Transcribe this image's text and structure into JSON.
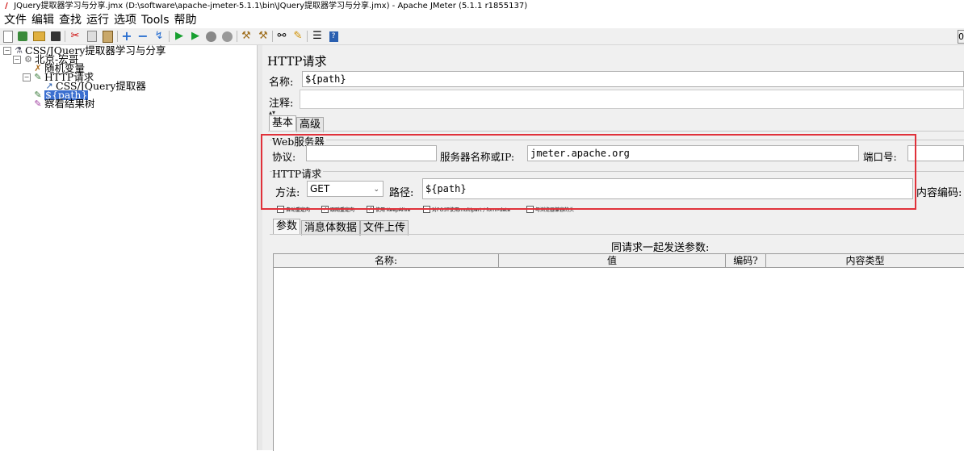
{
  "window": {
    "title": "JQuery提取器学习与分享.jmx (D:\\software\\apache-jmeter-5.1.1\\bin\\JQuery提取器学习与分享.jmx) - Apache JMeter (5.1.1 r1855137)"
  },
  "menu": [
    "文件",
    "编辑",
    "查找",
    "运行",
    "选项",
    "Tools",
    "帮助"
  ],
  "toolbar": {
    "icons": [
      "new-icon",
      "templates-icon",
      "open-icon",
      "save-icon",
      "cut-icon",
      "copy-icon",
      "paste-icon",
      "expand-icon",
      "collapse-icon",
      "toggle-icon",
      "start-icon",
      "start-no-pause-icon",
      "stop-icon",
      "shutdown-icon",
      "clear-icon",
      "clear-all-icon",
      "search-icon",
      "reset-search-icon",
      "function-helper-icon",
      "help-icon"
    ],
    "counter": "0"
  },
  "tree": {
    "items": [
      {
        "label": "CSS/JQuery提取器学习与分享",
        "icon": "test-plan-icon",
        "level": 0,
        "expanded": true
      },
      {
        "label": "北京-宏哥",
        "icon": "thread-group-icon",
        "level": 1,
        "expanded": true
      },
      {
        "label": "随机变量",
        "icon": "config-icon",
        "level": 2
      },
      {
        "label": "HTTP请求",
        "icon": "sampler-icon",
        "level": 2,
        "expanded": true
      },
      {
        "label": "CSS/JQuery提取器",
        "icon": "extractor-icon",
        "level": 3
      },
      {
        "label": "${path}",
        "icon": "sampler-icon",
        "level": 2,
        "selected": true
      },
      {
        "label": "察看结果树",
        "icon": "listener-icon",
        "level": 2
      }
    ]
  },
  "panel": {
    "title": "HTTP请求",
    "name_label": "名称:",
    "name_value": "${path}",
    "comment_label": "注释:",
    "comment_value": "",
    "tabs": [
      "基本",
      "高级"
    ],
    "web_server": {
      "legend": "Web服务器",
      "protocol_label": "协议:",
      "protocol_value": "",
      "server_label": "服务器名称或IP:",
      "server_value": "jmeter.apache.org",
      "port_label": "端口号:",
      "port_value": ""
    },
    "http_request": {
      "legend": "HTTP请求",
      "method_label": "方法:",
      "method_value": "GET",
      "path_label": "路径:",
      "path_value": "${path}",
      "encoding_label": "内容编码:"
    },
    "options": [
      {
        "label": "自动重定向",
        "checked": false
      },
      {
        "label": "跟随重定向",
        "checked": true
      },
      {
        "label": "使用 KeepAlive",
        "checked": true
      },
      {
        "label": "对POST使用multipart / form-data",
        "checked": false
      },
      {
        "label": "与浏览器兼容的头",
        "checked": false
      }
    ],
    "sub_tabs": [
      "参数",
      "消息体数据",
      "文件上传"
    ],
    "params_caption": "同请求一起发送参数:",
    "table_headers": [
      "名称:",
      "值",
      "编码?",
      "内容类型"
    ]
  }
}
